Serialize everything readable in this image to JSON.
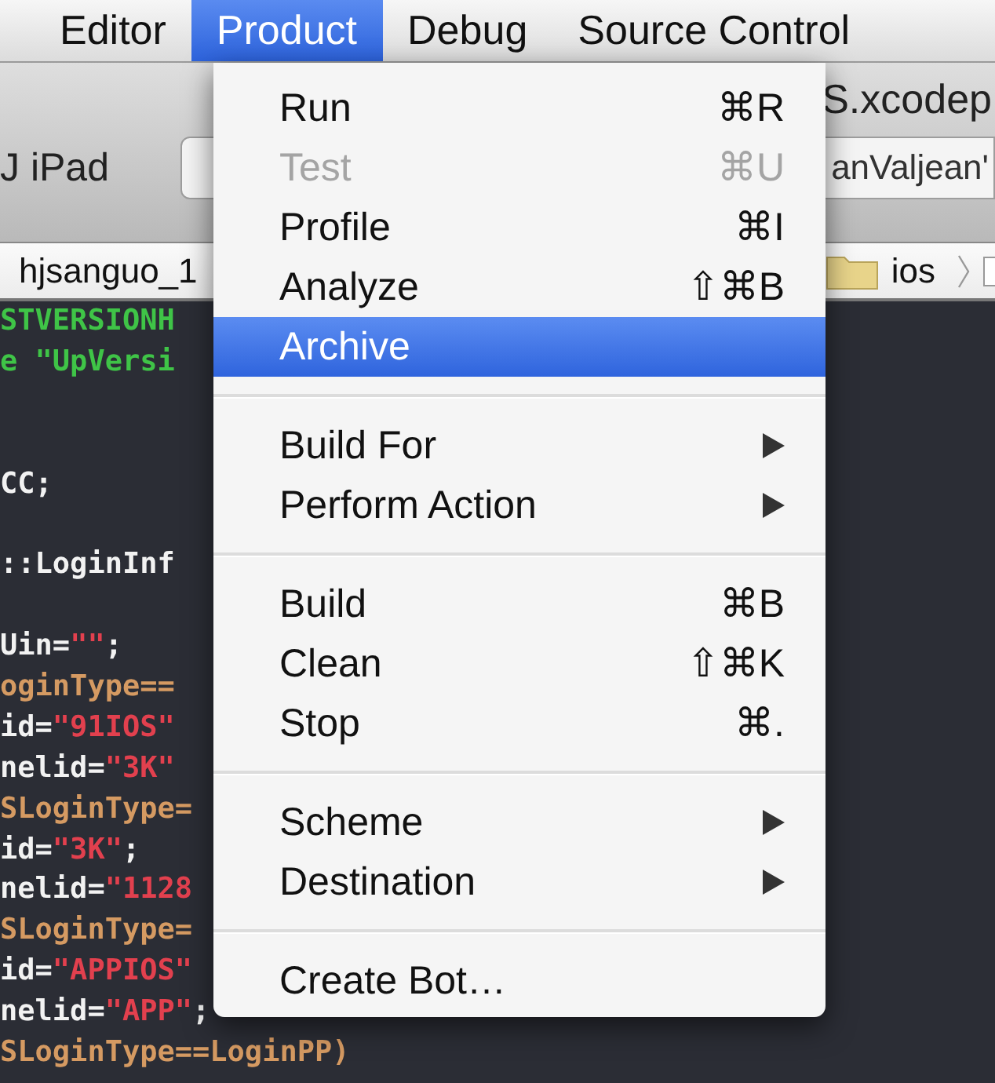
{
  "menu_bar": {
    "items": [
      {
        "label": "Editor",
        "selected": false
      },
      {
        "label": "Product",
        "selected": true
      },
      {
        "label": "Debug",
        "selected": false
      },
      {
        "label": "Source Control",
        "selected": false
      }
    ]
  },
  "toolbar": {
    "window_title": "S.xcodep",
    "scheme_label": "J iPad",
    "status_field": {
      "value": "anValjean'"
    }
  },
  "jump_bar": {
    "left": "hjsanguo_1",
    "folder": "ios"
  },
  "editor": {
    "lines": [
      {
        "kind": "code",
        "segments": [
          {
            "text": "STVERSIONH",
            "kind": "preprocessor"
          }
        ]
      },
      {
        "kind": "code",
        "segments": [
          {
            "text": "e \"UpVersi",
            "kind": "preprocessor"
          }
        ]
      },
      {
        "kind": "blank"
      },
      {
        "kind": "blank"
      },
      {
        "kind": "code",
        "segments": [
          {
            "text": "CC;",
            "kind": "plain"
          }
        ]
      },
      {
        "kind": "blank"
      },
      {
        "kind": "code",
        "segments": [
          {
            "text": "::LoginInf",
            "kind": "plain"
          }
        ]
      },
      {
        "kind": "blank"
      },
      {
        "kind": "code",
        "segments": [
          {
            "text": "Uin=",
            "kind": "plain"
          },
          {
            "text": "\"\"",
            "kind": "string"
          },
          {
            "text": ";",
            "kind": "plain"
          }
        ]
      },
      {
        "kind": "code",
        "segments": [
          {
            "text": "oginType==",
            "kind": "keyword"
          }
        ]
      },
      {
        "kind": "code",
        "segments": [
          {
            "text": "id=",
            "kind": "plain"
          },
          {
            "text": "\"91IOS\"",
            "kind": "string"
          }
        ]
      },
      {
        "kind": "code",
        "segments": [
          {
            "text": "nelid=",
            "kind": "plain"
          },
          {
            "text": "\"3K\"",
            "kind": "string"
          }
        ]
      },
      {
        "kind": "code",
        "segments": [
          {
            "text": "SLoginType=",
            "kind": "keyword"
          }
        ]
      },
      {
        "kind": "code",
        "segments": [
          {
            "text": "id=",
            "kind": "plain"
          },
          {
            "text": "\"3K\"",
            "kind": "string"
          },
          {
            "text": ";",
            "kind": "plain"
          }
        ]
      },
      {
        "kind": "code",
        "segments": [
          {
            "text": "nelid=",
            "kind": "plain"
          },
          {
            "text": "\"1128",
            "kind": "string"
          }
        ]
      },
      {
        "kind": "code",
        "segments": [
          {
            "text": "SLoginType=",
            "kind": "keyword"
          }
        ]
      },
      {
        "kind": "code",
        "segments": [
          {
            "text": "id=",
            "kind": "plain"
          },
          {
            "text": "\"APPIOS\"",
            "kind": "string"
          }
        ]
      },
      {
        "kind": "code",
        "segments": [
          {
            "text": "nelid=",
            "kind": "plain"
          },
          {
            "text": "\"APP\"",
            "kind": "string"
          },
          {
            "text": ";",
            "kind": "plain"
          }
        ]
      },
      {
        "kind": "code",
        "segments": [
          {
            "text": "SLoginType==LoginPP)",
            "kind": "keyword"
          }
        ]
      }
    ]
  },
  "menu": {
    "items": [
      {
        "kind": "command",
        "label": "Run",
        "shortcut": "⌘R",
        "disabled": false,
        "selected": false
      },
      {
        "kind": "command",
        "label": "Test",
        "shortcut": "⌘U",
        "disabled": true,
        "selected": false
      },
      {
        "kind": "command",
        "label": "Profile",
        "shortcut": "⌘I",
        "disabled": false,
        "selected": false
      },
      {
        "kind": "command",
        "label": "Analyze",
        "shortcut": "⇧⌘B",
        "disabled": false,
        "selected": false
      },
      {
        "kind": "command",
        "label": "Archive",
        "disabled": false,
        "selected": true
      },
      {
        "kind": "separator"
      },
      {
        "kind": "submenu",
        "label": "Build For",
        "disabled": false,
        "selected": false
      },
      {
        "kind": "submenu",
        "label": "Perform Action",
        "disabled": false,
        "selected": false
      },
      {
        "kind": "separator"
      },
      {
        "kind": "command",
        "label": "Build",
        "shortcut": "⌘B",
        "disabled": false,
        "selected": false
      },
      {
        "kind": "command",
        "label": "Clean",
        "shortcut": "⇧⌘K",
        "disabled": false,
        "selected": false
      },
      {
        "kind": "command",
        "label": "Stop",
        "shortcut": "⌘.",
        "disabled": false,
        "selected": false
      },
      {
        "kind": "separator"
      },
      {
        "kind": "submenu",
        "label": "Scheme",
        "disabled": false,
        "selected": false
      },
      {
        "kind": "submenu",
        "label": "Destination",
        "disabled": false,
        "selected": false
      },
      {
        "kind": "separator"
      },
      {
        "kind": "command",
        "label": "Create Bot…",
        "disabled": false,
        "selected": false
      }
    ]
  }
}
